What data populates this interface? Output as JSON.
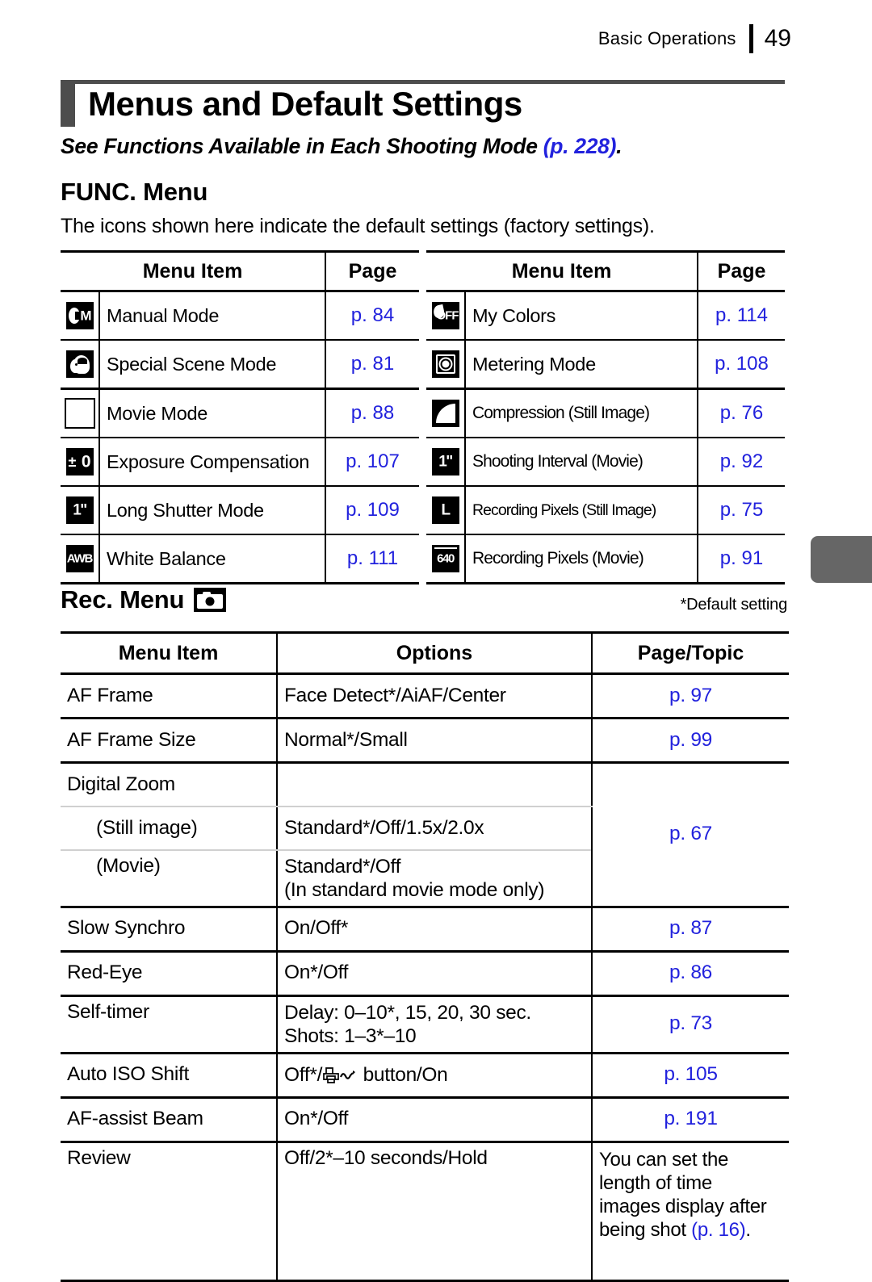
{
  "header": {
    "chapter": "Basic Operations",
    "page_number": "49"
  },
  "title": "Menus and Default Settings",
  "subtitle": {
    "text": "See Functions Available in Each Shooting Mode ",
    "page_ref": "(p. 228)",
    "period": "."
  },
  "func_section": {
    "heading": "FUNC. Menu",
    "intro": "The icons shown here indicate the default settings (factory settings).",
    "columns": [
      "Menu Item",
      "Page"
    ],
    "left_rows": [
      {
        "icon": "manual-mode-icon",
        "label": "Manual Mode",
        "page": "p. 84",
        "thick_below": false
      },
      {
        "icon": "special-scene-mode-icon",
        "label": "Special Scene Mode",
        "page": "p. 81",
        "thick_below": true
      },
      {
        "icon": "movie-mode-icon",
        "label": "Movie Mode",
        "page": "p. 88",
        "thick_below": false
      },
      {
        "icon": "exposure-compensation-icon",
        "label": "Exposure Compensation",
        "page": "p. 107",
        "thick_below": false
      },
      {
        "icon": "long-shutter-mode-icon",
        "label": "Long Shutter Mode",
        "page": "p. 109",
        "thick_below": false
      },
      {
        "icon": "white-balance-icon",
        "label": "White Balance",
        "page": "p. 111",
        "thick_below": false
      }
    ],
    "right_rows": [
      {
        "icon": "my-colors-icon",
        "label": "My Colors",
        "page": "p. 114",
        "thick_below": false
      },
      {
        "icon": "metering-mode-icon",
        "label": "Metering Mode",
        "page": "p. 108",
        "thick_below": true
      },
      {
        "icon": "compression-icon",
        "label": "Compression (Still Image)",
        "page": "p. 76",
        "thick_below": false
      },
      {
        "icon": "shooting-interval-icon",
        "label": "Shooting Interval (Movie)",
        "page": "p. 92",
        "thick_below": false
      },
      {
        "icon": "recording-pixels-still-icon",
        "label": "Recording Pixels (Still Image)",
        "page": "p. 75",
        "thick_below": false
      },
      {
        "icon": "recording-pixels-movie-icon",
        "label": "Recording Pixels (Movie)",
        "page": "p. 91",
        "thick_below": false
      }
    ]
  },
  "rec_section": {
    "heading": "Rec. Menu",
    "heading_icon": "camera-icon",
    "default_note": "*Default setting",
    "columns": [
      "Menu Item",
      "Options",
      "Page/Topic"
    ],
    "rows": {
      "af_frame": {
        "label": "AF Frame",
        "options": "Face Detect*/AiAF/Center",
        "page": "p. 97"
      },
      "af_frame_size": {
        "label": "AF Frame Size",
        "options": "Normal*/Small",
        "page": "p. 99"
      },
      "digital_zoom": {
        "label": "Digital Zoom",
        "options": "",
        "page": "p. 67"
      },
      "digital_zoom_still": {
        "label": "(Still image)",
        "options": "Standard*/Off/1.5x/2.0x"
      },
      "digital_zoom_movie": {
        "label": "(Movie)",
        "options_line1": "Standard*/Off",
        "options_line2": "(In standard movie mode only)"
      },
      "slow_synchro": {
        "label": "Slow Synchro",
        "options": "On/Off*",
        "page": "p. 87"
      },
      "red_eye": {
        "label": "Red-Eye",
        "options": "On*/Off",
        "page": "p. 86"
      },
      "self_timer": {
        "label": "Self-timer",
        "options_line1": "Delay: 0–10*, 15, 20, 30 sec.",
        "options_line2": "Shots: 1–3*–10",
        "page": "p. 73"
      },
      "auto_iso_shift": {
        "label": "Auto ISO Shift",
        "options_prefix": "Off*/",
        "options_icon": "print-share-button-icon",
        "options_suffix": " button/On",
        "page": "p. 105"
      },
      "af_assist_beam": {
        "label": "AF-assist Beam",
        "options": "On*/Off",
        "page": "p. 191"
      },
      "review": {
        "label": "Review",
        "options": "Off/2*–10 seconds/Hold",
        "topic_line1": "You can set the",
        "topic_line2": "length of time",
        "topic_line3": "images display after",
        "topic_line4_a": "being shot ",
        "topic_line4_ref": "(p. 16)",
        "topic_line4_b": "."
      }
    }
  },
  "colors": {
    "link": "#2222dd",
    "banner": "#4d4d4d",
    "thumb_tab": "#666666"
  }
}
